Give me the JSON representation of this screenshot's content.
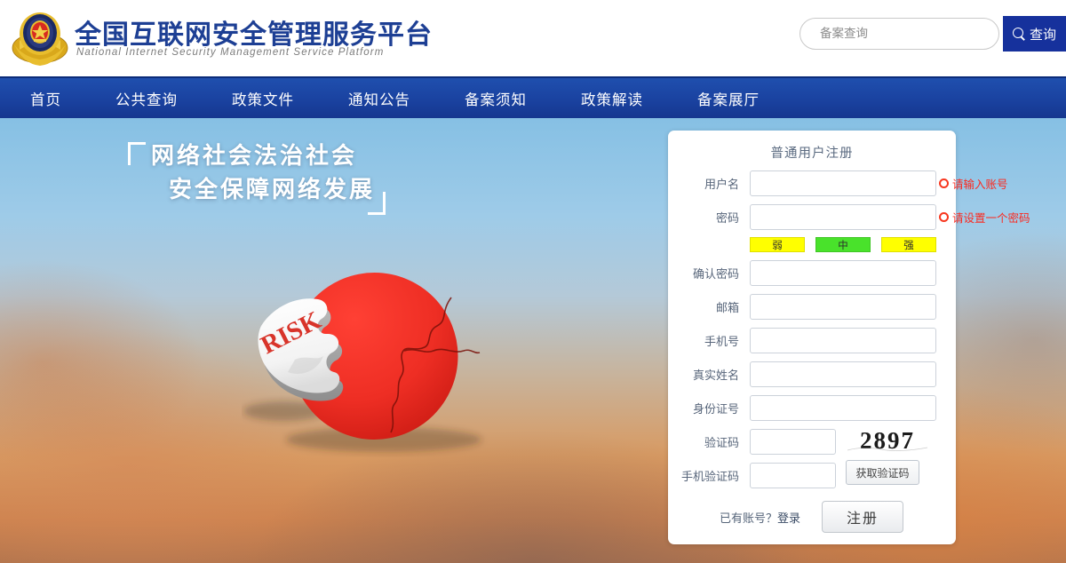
{
  "header": {
    "logo_icon": "police-badge-icon",
    "brand_cn": "全国互联网安全管理服务平台",
    "brand_en": "National Internet Security Management Service Platform",
    "brand_color": "#1d3f94",
    "search": {
      "placeholder": "备案查询",
      "value": "",
      "button_label": "查询",
      "button_icon": "search-icon",
      "button_color": "#16319c"
    }
  },
  "nav": {
    "background": "#1a42a0",
    "items": [
      {
        "label": "首页"
      },
      {
        "label": "公共查询"
      },
      {
        "label": "政策文件"
      },
      {
        "label": "通知公告"
      },
      {
        "label": "备案须知"
      },
      {
        "label": "政策解读"
      },
      {
        "label": "备案展厅"
      }
    ]
  },
  "hero": {
    "slogan_line1": "网络社会法治社会",
    "slogan_line2": "安全保障网络发展",
    "puzzle_label": "RISK",
    "puzzle_color": "#ee2e24"
  },
  "register": {
    "title": "普通用户注册",
    "fields": [
      {
        "label": "用户名",
        "value": "",
        "error": "请输入账号"
      },
      {
        "label": "密码",
        "value": "",
        "error": "请设置一个密码"
      },
      {
        "label": "确认密码",
        "value": "",
        "error": ""
      },
      {
        "label": "邮箱",
        "value": "",
        "error": ""
      },
      {
        "label": "手机号",
        "value": "",
        "error": ""
      },
      {
        "label": "真实姓名",
        "value": "",
        "error": ""
      },
      {
        "label": "身份证号",
        "value": "",
        "error": ""
      },
      {
        "label": "验证码",
        "value": "",
        "error": ""
      },
      {
        "label": "手机验证码",
        "value": "",
        "error": ""
      }
    ],
    "strength": {
      "weak": "弱",
      "medium": "中",
      "strong": "强",
      "weak_color": "#ffff00",
      "medium_color": "#49e22b",
      "strong_color": "#ffff00"
    },
    "captcha_code": "2897",
    "sms_button": "获取验证码",
    "have_account_text": "已有账号？",
    "login_link": "登录",
    "submit_label": "注册",
    "error_color": "#fb2a20"
  }
}
